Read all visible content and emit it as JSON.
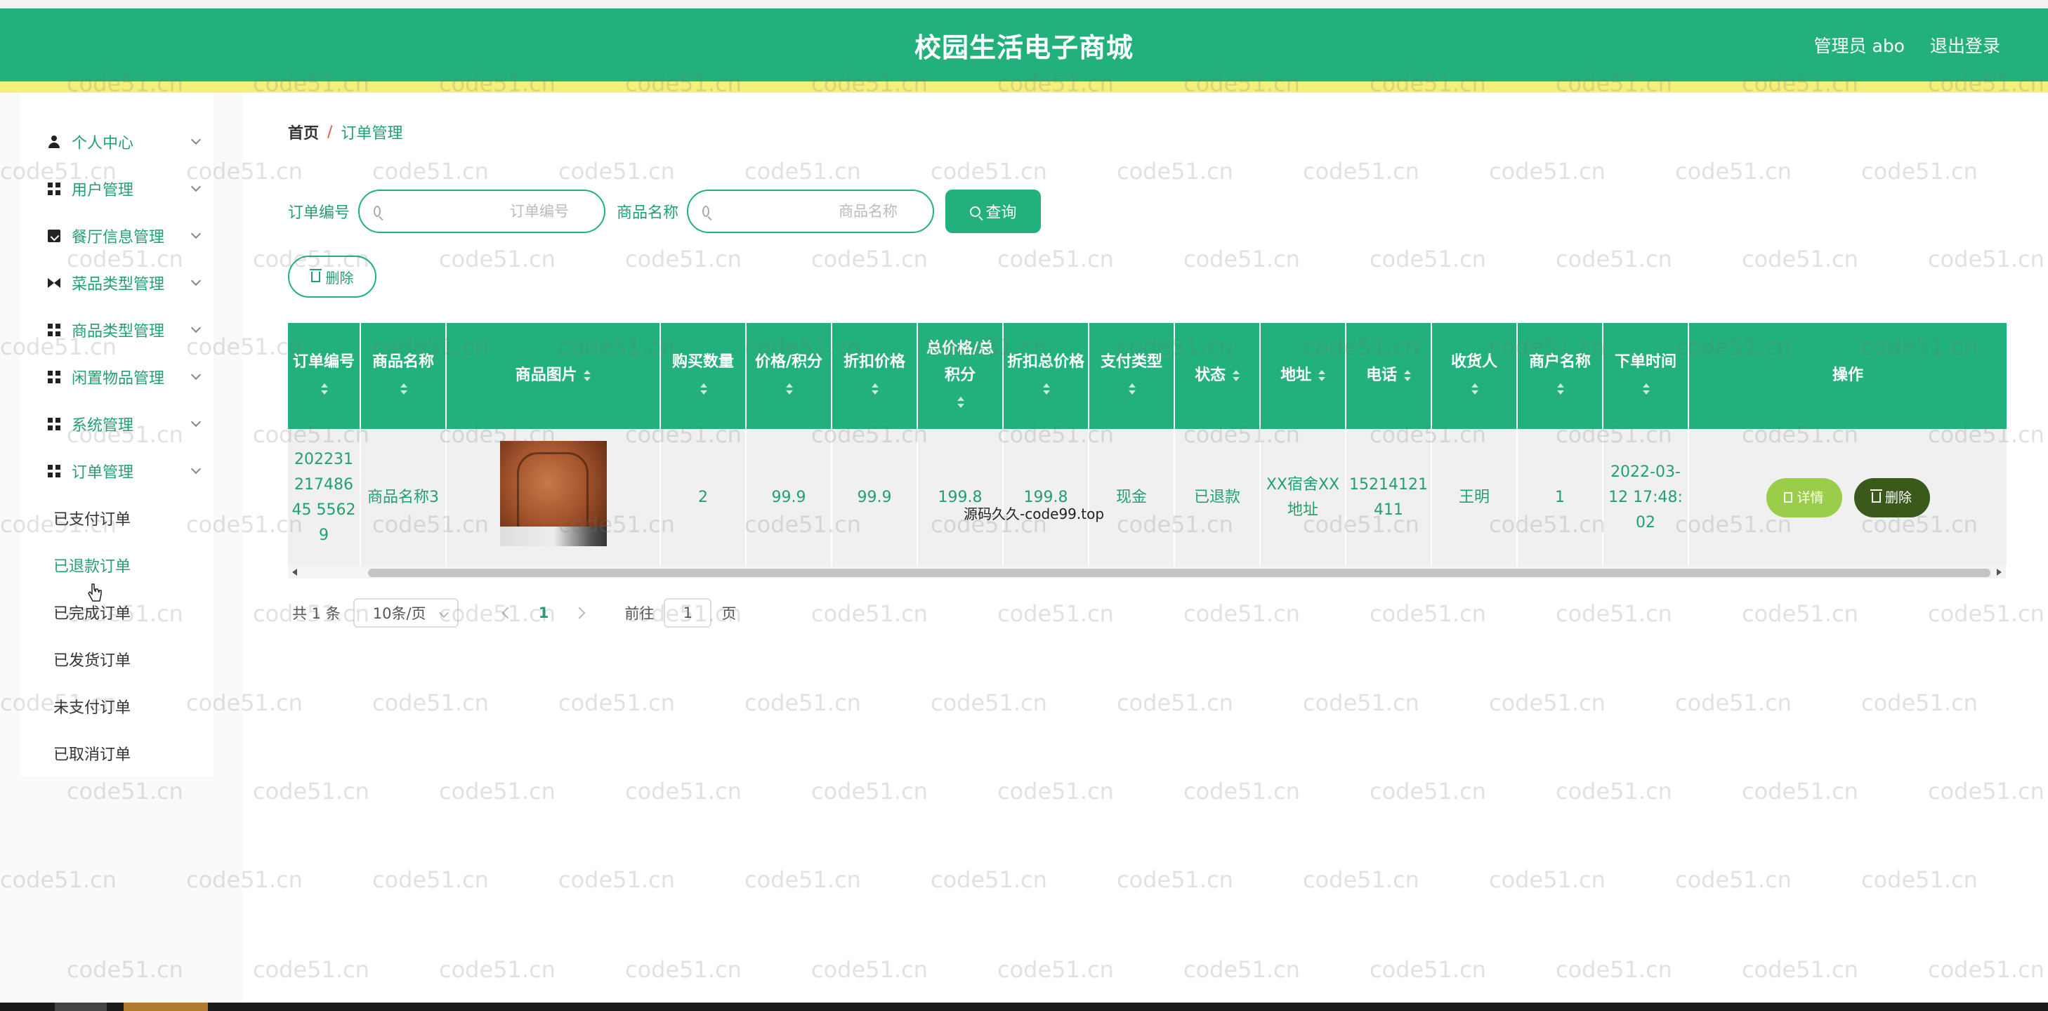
{
  "header": {
    "title": "校园生活电子商城",
    "user": "管理员 abo",
    "logout": "退出登录"
  },
  "sidebar": {
    "items": [
      {
        "label": "个人中心",
        "icon": "person-icon"
      },
      {
        "label": "用户管理",
        "icon": "grid-icon"
      },
      {
        "label": "餐厅信息管理",
        "icon": "clipboard-icon"
      },
      {
        "label": "菜品类型管理",
        "icon": "bowtie-icon"
      },
      {
        "label": "商品类型管理",
        "icon": "grid-icon"
      },
      {
        "label": "闲置物品管理",
        "icon": "grid-icon"
      },
      {
        "label": "系统管理",
        "icon": "grid-icon"
      },
      {
        "label": "订单管理",
        "icon": "grid-icon"
      }
    ],
    "submenu": [
      "已支付订单",
      "已退款订单",
      "已完成订单",
      "已发货订单",
      "未支付订单",
      "已取消订单"
    ]
  },
  "breadcrumb": {
    "home": "首页",
    "separator": "/",
    "current": "订单管理"
  },
  "search": {
    "order_no_label": "订单编号",
    "order_no_placeholder": "订单编号",
    "product_name_label": "商品名称",
    "product_name_placeholder": "商品名称",
    "query_label": "查询"
  },
  "toolbar": {
    "delete_label": "删除"
  },
  "table": {
    "columns": [
      "订单编号",
      "商品名称",
      "商品图片",
      "购买数量",
      "价格/积分",
      "折扣价格",
      "总价格/总积分",
      "折扣总价格",
      "支付类型",
      "状态",
      "地址",
      "电话",
      "收货人",
      "商户名称",
      "下单时间",
      "操作"
    ],
    "rows": [
      {
        "order_no": "20223121748645 55629",
        "product_name": "商品名称3",
        "quantity": "2",
        "price": "99.9",
        "discount_price": "99.9",
        "total": "199.8",
        "discount_total": "199.8",
        "pay_type": "现金",
        "status": "已退款",
        "address": "XX宿舍XX地址",
        "phone": "15214121411",
        "receiver": "王明",
        "merchant": "1",
        "order_time": "2022-03-12 17:48:02",
        "detail_label": "详情",
        "delete_label": "删除"
      }
    ]
  },
  "pager": {
    "total": "共 1 条",
    "page_size": "10条/页",
    "current_page": "1",
    "goto_label": "前往",
    "goto_value": "1",
    "page_suffix": "页"
  },
  "watermark": {
    "text": "code51.cn",
    "center_text": "源码久久-code99.top"
  },
  "colors": {
    "primary": "#22b07d",
    "yellow": "#f5f07a",
    "detail_btn": "#9acd4a",
    "delete_btn": "#3a5a1c"
  }
}
